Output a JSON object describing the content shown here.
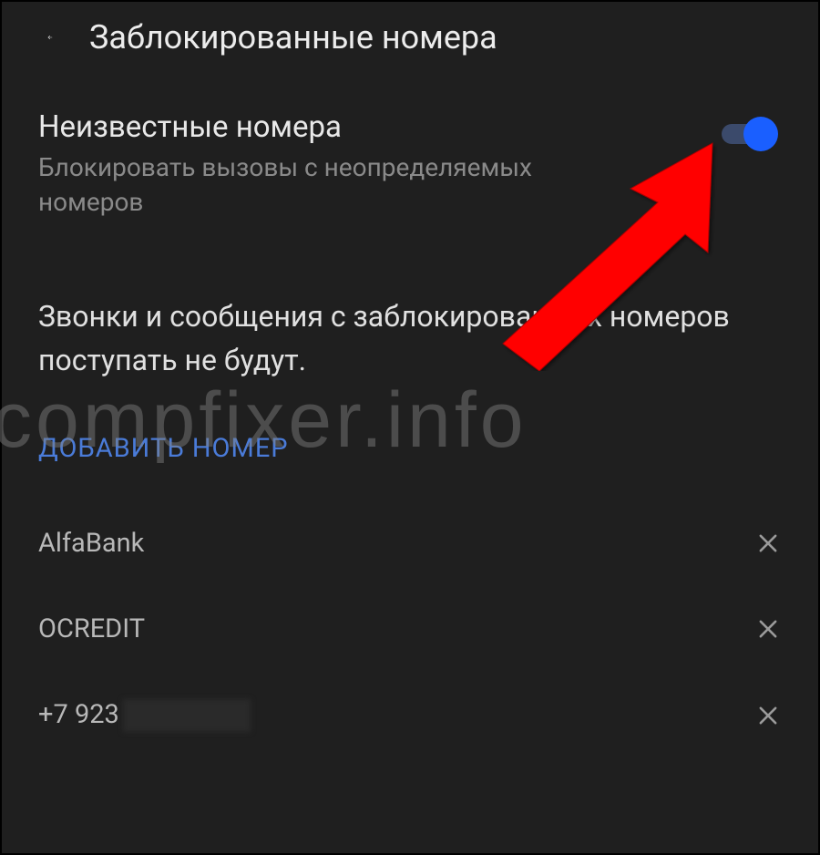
{
  "header": {
    "title": "Заблокированные номера"
  },
  "unknown_numbers": {
    "title": "Неизвестные номера",
    "subtitle": "Блокировать вызовы с неопределяемых номеров",
    "enabled": true
  },
  "info_text": "Звонки и сообщения с заблокированных номеров поступать не будут.",
  "add_number_label": "ДОБАВИТЬ НОМЕР",
  "blocked_items": [
    {
      "name": "AlfaBank"
    },
    {
      "name": "OCREDIT"
    },
    {
      "name": "+7 923"
    }
  ],
  "watermark": "compfixer.info"
}
